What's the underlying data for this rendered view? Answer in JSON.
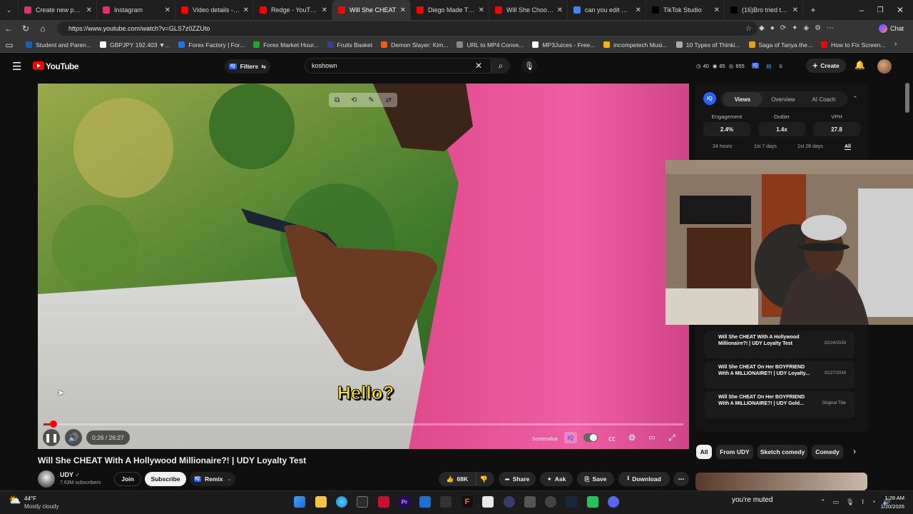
{
  "browser": {
    "tabs": [
      {
        "title": "Create new post • In",
        "color": "#e1306c"
      },
      {
        "title": "Instagram",
        "color": "#e1306c"
      },
      {
        "title": "Video details - YouTu",
        "color": "#ff0000"
      },
      {
        "title": "Redge - YouTube",
        "color": "#ff0000"
      },
      {
        "title": "Will She CHEAT",
        "color": "#ff0000",
        "active": true
      },
      {
        "title": "Diego Made This Ga",
        "color": "#ff0000"
      },
      {
        "title": "Will She Choose A L",
        "color": "#ff0000"
      },
      {
        "title": "can you edit mpg fil",
        "color": "#4285f4"
      },
      {
        "title": "TikTok Studio",
        "color": "#000000"
      },
      {
        "title": "(16)Bro tried to sne",
        "color": "#000000"
      }
    ],
    "url": "https://www.youtube.com/watch?v=GLS7z0ZZUto",
    "chat_label": "Chat",
    "bookmarks": [
      {
        "label": "Student and Paren...",
        "color": "#1a5fb4"
      },
      {
        "label": "GBPJPY 192.403 ▼...",
        "color": "#ffffff"
      },
      {
        "label": "Forex Factory | For...",
        "color": "#2d6fd6"
      },
      {
        "label": "Forex Market Hour...",
        "color": "#22aa22"
      },
      {
        "label": "Fruits Basket",
        "color": "#3b3b8f"
      },
      {
        "label": "Demon Slayer: Kim...",
        "color": "#e85c1c"
      },
      {
        "label": "URL to MP4 Conve...",
        "color": "#888888"
      },
      {
        "label": "MP3Juices - Free...",
        "color": "#ffffff"
      },
      {
        "label": "incompetech Musi...",
        "color": "#f2b705"
      },
      {
        "label": "10 Types of Thinki...",
        "color": "#aaaaaa"
      },
      {
        "label": "Saga of Tanya the...",
        "color": "#e0a020"
      },
      {
        "label": "How to Fix Screen...",
        "color": "#ff0000"
      }
    ]
  },
  "youtube": {
    "logo_text": "YouTube",
    "filters_label": "Filters",
    "search_value": "koshown",
    "header_counts": [
      "40",
      "85",
      "655"
    ],
    "create_label": "Create"
  },
  "video": {
    "caption": "Hello?",
    "time": "0:26 / 26:27",
    "progress": 0.016,
    "screenshot_label": "Screenshot"
  },
  "meta": {
    "title": "Will She CHEAT With A Hollywood Millionaire?! | UDY Loyalty Test",
    "channel": "UDY",
    "subscribers": "7.63M subscribers",
    "join_label": "Join",
    "subscribe_label": "Subscribe",
    "remix_label": "Remix",
    "likes": "68K",
    "share_label": "Share",
    "ask_label": "Ask",
    "save_label": "Save",
    "download_label": "Download"
  },
  "iq_panel": {
    "badge": "IQ",
    "tabs": [
      "Views",
      "Overview",
      "AI Coach"
    ],
    "stats": [
      {
        "label": "Engagement",
        "value": "2.4%"
      },
      {
        "label": "Outlier",
        "value": "1.4x"
      },
      {
        "label": "VPH",
        "value": "27.8"
      }
    ],
    "ranges": [
      "24 hours",
      "1st 7 days",
      "1st 28 days",
      "All"
    ],
    "history": [
      {
        "title": "Will She CHEAT With A Hollywood Millionaire?! | UDY Loyalty Test",
        "date": "02/24/2024"
      },
      {
        "title": "Will She CHEAT On Her BOYFRIEND With A MILLIONAIRE?! | UDY Loyalty...",
        "date": "01/27/2024"
      },
      {
        "title": "Will She CHEAT On Her BOYFRIEND With A MILLIONAIRE?! | UDY Gold...",
        "date": "Original Title"
      }
    ]
  },
  "chips": [
    "All",
    "From UDY",
    "Sketch comedy",
    "Comedy"
  ],
  "taskbar": {
    "temperature": "44°F",
    "weather": "Mostly cloudy",
    "muted_text": "you're muted",
    "time": "1:28 AM",
    "date": "1/20/2026"
  }
}
